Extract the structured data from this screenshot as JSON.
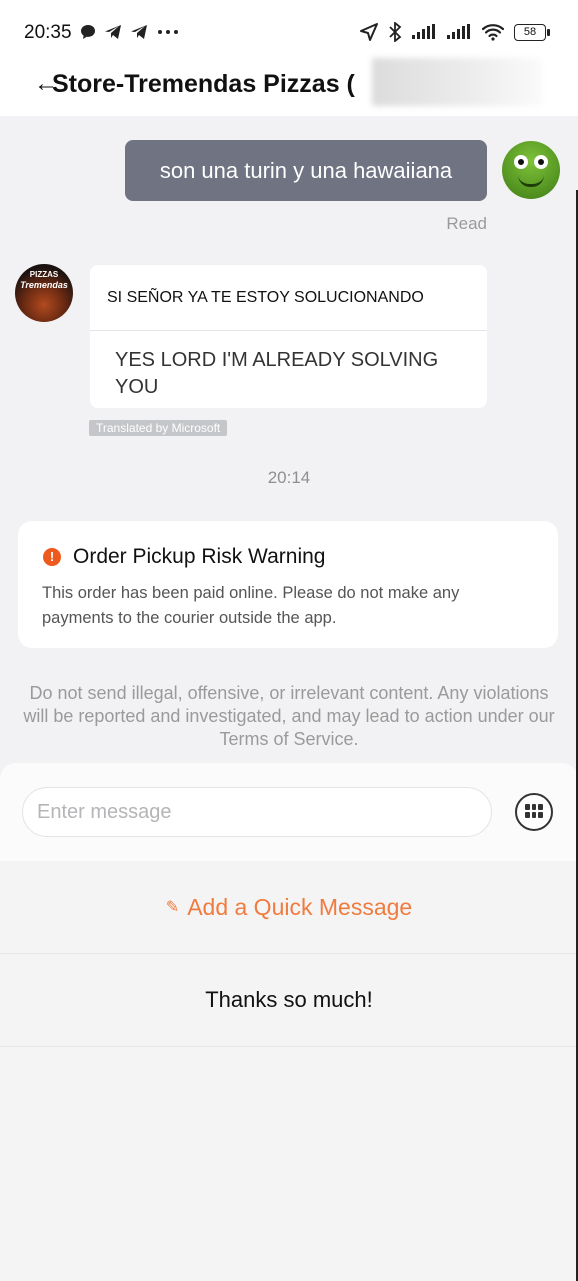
{
  "status_bar": {
    "time": "20:35",
    "battery": "58",
    "icons": [
      "chat-bubble-icon",
      "telegram-icon",
      "telegram-icon",
      "more-dots-icon",
      "location-icon",
      "bluetooth-icon",
      "signal-icon",
      "signal-icon",
      "wifi-icon",
      "battery-icon"
    ]
  },
  "header": {
    "title": "Store-Tremendas Pizzas (",
    "back_icon": "back-arrow-icon"
  },
  "messages": {
    "outgoing": {
      "text": "son una turin y una hawaiiana",
      "status": "Read"
    },
    "incoming": {
      "original": "SI SEÑOR YA TE ESTOY SOLUCIONANDO",
      "translated": "YES LORD I'M ALREADY SOLVING YOU",
      "translated_tag": "Translated by Microsoft"
    },
    "store_avatar_text": "PIZZAS",
    "store_avatar_sub": "Tremendas",
    "timestamp": "20:14"
  },
  "warning": {
    "icon": "!",
    "title": "Order Pickup Risk Warning",
    "body": "This order has been paid online. Please do not make any payments to the courier outside the app."
  },
  "policy_notice": "Do not send illegal, offensive, or irrelevant content. Any violations will be reported and investigated, and may lead to action under our Terms of Service.",
  "composer": {
    "placeholder": "Enter message",
    "value": ""
  },
  "quick_messages": {
    "add_label": "Add a Quick Message",
    "items": [
      "Thanks so much!"
    ]
  },
  "colors": {
    "accent": "#f07b3f",
    "warning": "#ee5a1e",
    "outgoing_bubble": "#6f7382"
  }
}
